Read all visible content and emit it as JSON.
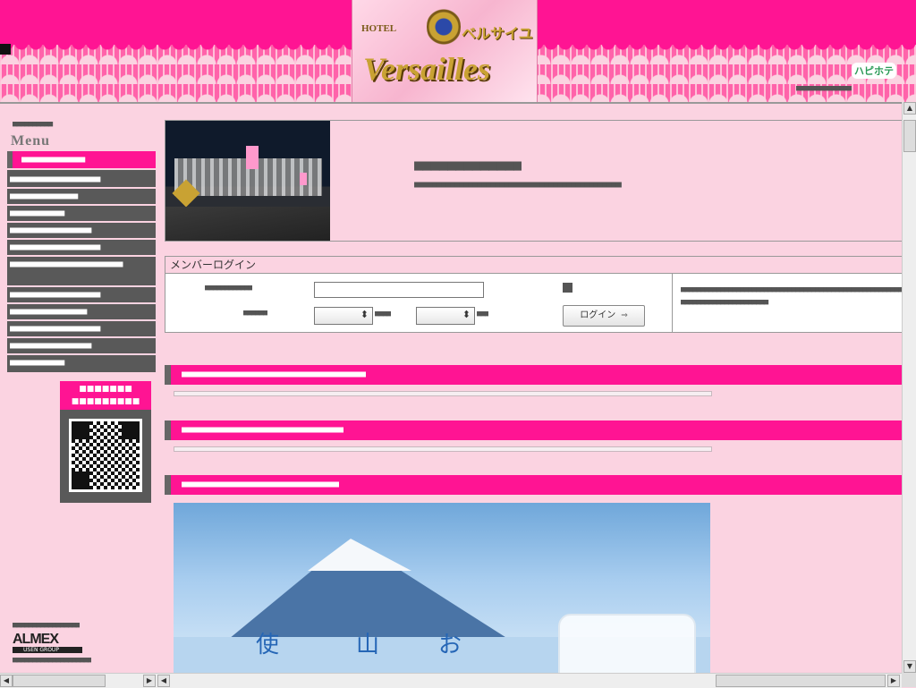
{
  "header": {
    "logo_hotel": "HOTEL",
    "logo_jp": "ベルサイユ",
    "logo_brand": "Versailles",
    "happy_badge": "ハピホテ",
    "right_text": "■■■■■■■■■■■■■■"
  },
  "sidebar": {
    "label": "■■■■■■■■■■",
    "menu_title": "Menu",
    "menu_head": "■■■■■■■■■■■■■■",
    "items": [
      "■■■■■■■■■■■■■■■■■■■■",
      "■■■■■■■■■■■■■■■",
      "■■■■■■■■■■■■",
      "■■■■■■■■■■■■■■■■■■",
      "■■■■■■■■■■■■■■■■■■■■",
      "■■■■■■■■■■■■■■■■■■■■■■■■■",
      "■■■■■■■■■■■■■■■■■■■■",
      "■■■■■■■■■■■■■■■■■",
      "■■■■■■■■■■■■■■■■■■■■",
      "■■■■■■■■■■■■■■■■■■",
      "■■■■■■■■■■■■"
    ],
    "qr_head": "■■■■■■■ ■■■■■■■■■",
    "almex_label": "■■■■■■■■■■■■■■■■■",
    "almex_brand": "ALMEX",
    "almex_group": "USEN GROUP",
    "almex_text": "■■■■■■■■■■■■■■■■■■■■"
  },
  "hero": {
    "title": "■■■■■■■■■■■■■",
    "desc": "■■■■■■■■■■■■■■■■■■■■■■■■■■■■■■■■■■■■■■■■■■■■■■"
  },
  "login": {
    "title": "メンバーログイン",
    "field_label": "■■■■■■■■■■■■",
    "input_value": "",
    "input_placeholder": "",
    "date_label": "■■■■■■",
    "select_a": "",
    "select_a_unit": "■■■■",
    "select_b": "",
    "select_b_unit": "■■■",
    "button_label": "ログイン",
    "button_arrow": "⇒",
    "note": "■■■■■■■■■■■■■■■■■■■■■■■■■■■■■■■■■■■■■■■■■■■■■■■■■■■■■■■■■■■■■■■■■■■■■■■■■■■■■■"
  },
  "sections": [
    "■■■■■■■■■■■■■■■■■■■■■■■■■■■■■■■■■■■■■■■■■",
    "■■■■■■■■■■■■■■■■■■■■■■■■■■■■■■■■■■■■",
    "■■■■■■■■■■■■■■■■■■■■■■■■■■■■■■■■■■■"
  ],
  "poster": {
    "chars": [
      "使",
      "山",
      "お"
    ]
  },
  "scrollbar": {
    "up": "▲",
    "down": "▼",
    "left": "◀",
    "right": "▶"
  }
}
